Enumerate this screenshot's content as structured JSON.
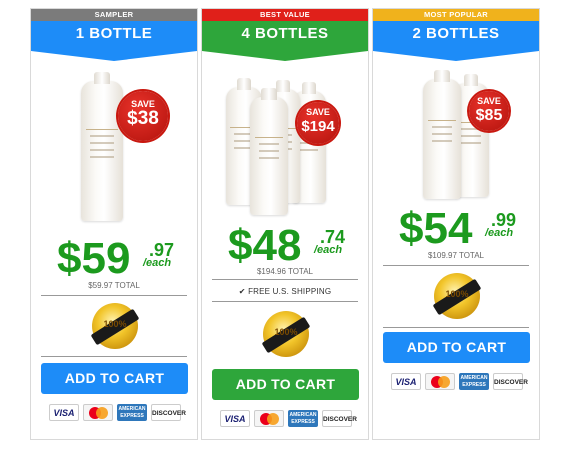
{
  "offers": [
    {
      "tag": "SAMPLER",
      "tag_color": "#7b7b7b",
      "title": "1 BOTTLE",
      "header_color": "#1d8cf8",
      "save_label": "SAVE",
      "save_amount": "$38",
      "price_dollars": "$59",
      "price_cents": ".97",
      "per": "/each",
      "total": "$59.97 TOTAL",
      "shipping": "",
      "seal_text": "100%",
      "button_label": "ADD TO CART",
      "button_color": "#1d8cf8",
      "bottle_count": 1
    },
    {
      "tag": "BEST VALUE",
      "tag_color": "#e0201a",
      "title": "4 BOTTLES",
      "header_color": "#2ea63b",
      "save_label": "SAVE",
      "save_amount": "$194",
      "price_dollars": "$48",
      "price_cents": ".74",
      "per": "/each",
      "total": "$194.96 TOTAL",
      "shipping": "✔ FREE U.S. SHIPPING",
      "seal_text": "100%",
      "button_label": "ADD TO CART",
      "button_color": "#2ea63b",
      "bottle_count": 4
    },
    {
      "tag": "MOST POPULAR",
      "tag_color": "#f0b21c",
      "title": "2 BOTTLES",
      "header_color": "#1d8cf8",
      "save_label": "SAVE",
      "save_amount": "$85",
      "price_dollars": "$54",
      "price_cents": ".99",
      "per": "/each",
      "total": "$109.97 TOTAL",
      "shipping": "",
      "seal_text": "100%",
      "button_label": "ADD TO CART",
      "button_color": "#1d8cf8",
      "bottle_count": 2
    }
  ],
  "payment_cards": {
    "visa": "VISA",
    "mastercard": "mastercard-logo",
    "amex": "AMERICAN EXPRESS",
    "discover": "DISCOVER"
  },
  "icons": [
    "checkmark-icon",
    "money-back-guarantee-seal-icon",
    "visa-icon",
    "mastercard-icon",
    "amex-icon",
    "discover-icon"
  ],
  "colors": {
    "price_green": "#1c9a1e",
    "badge_red": "#c9180f"
  }
}
